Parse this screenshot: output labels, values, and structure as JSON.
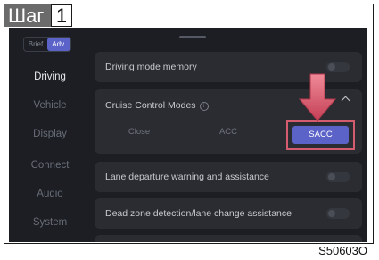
{
  "step": {
    "label": "Шаг",
    "number": "1"
  },
  "mode_toggle": {
    "brief": "Brief",
    "adv": "Adv."
  },
  "sidebar": {
    "items": [
      {
        "label": "Driving"
      },
      {
        "label": "Vehicle"
      },
      {
        "label": "Display"
      },
      {
        "label": "Connect"
      },
      {
        "label": "Audio"
      },
      {
        "label": "System"
      }
    ]
  },
  "settings": {
    "driving_mode_memory": "Driving mode memory",
    "cruise_control_modes": "Cruise Control Modes",
    "info_symbol": "i",
    "cruise_options": {
      "close": "Close",
      "acc": "ACC",
      "sacc": "SACC"
    },
    "lane_departure": "Lane departure warning and assistance",
    "dead_zone": "Dead zone detection/lane change assistance"
  },
  "image_code": "S50603O",
  "colors": {
    "accent": "#5b62c8",
    "highlight": "#d35c6e",
    "screen_bg": "#1c1e23",
    "card_bg": "#2a2c32"
  }
}
